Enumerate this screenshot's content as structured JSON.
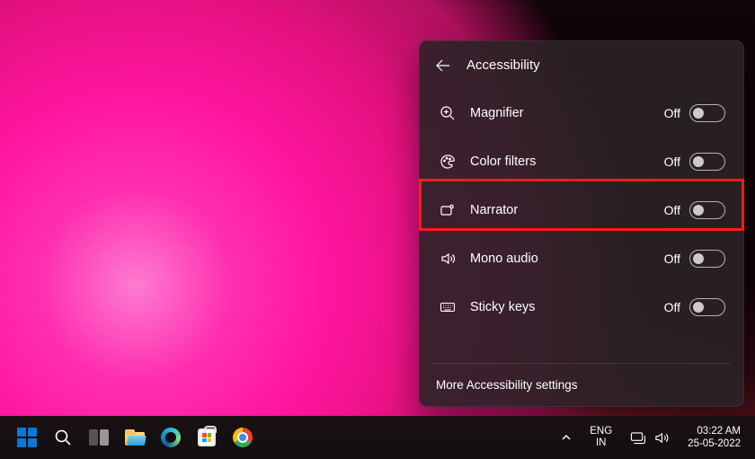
{
  "panel": {
    "title": "Accessibility",
    "items": [
      {
        "icon": "magnifier",
        "label": "Magnifier",
        "state": "Off",
        "on": false
      },
      {
        "icon": "palette",
        "label": "Color filters",
        "state": "Off",
        "on": false
      },
      {
        "icon": "narrator",
        "label": "Narrator",
        "state": "Off",
        "on": false,
        "highlighted": true
      },
      {
        "icon": "speaker",
        "label": "Mono audio",
        "state": "Off",
        "on": false
      },
      {
        "icon": "keyboard",
        "label": "Sticky keys",
        "state": "Off",
        "on": false
      }
    ],
    "more_link": "More Accessibility settings"
  },
  "taskbar": {
    "lang_top": "ENG",
    "lang_bottom": "IN",
    "time": "03:22 AM",
    "date": "25-05-2022"
  }
}
